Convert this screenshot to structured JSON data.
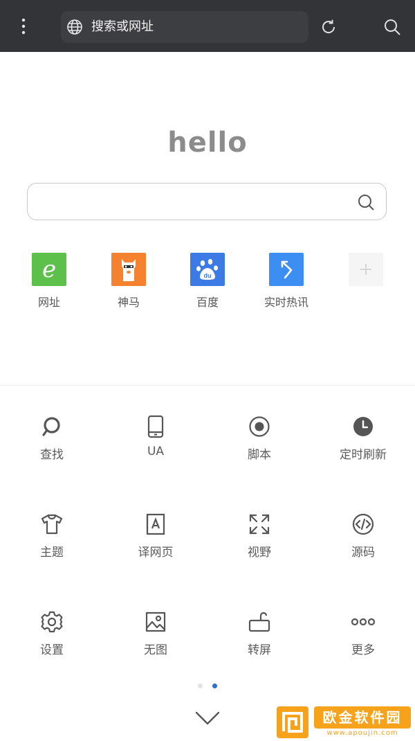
{
  "topbar": {
    "url_placeholder": "搜索或网址",
    "icons": [
      "more-vert-icon",
      "globe-icon",
      "refresh-icon",
      "search-icon"
    ]
  },
  "home": {
    "greeting": "hello",
    "search_icon": "search-icon"
  },
  "shortcuts": [
    {
      "label": "网址",
      "icon": "url-e-icon",
      "color": "#5cc04a"
    },
    {
      "label": "神马",
      "icon": "alpaca-icon",
      "color": "#f5822f"
    },
    {
      "label": "百度",
      "icon": "baidu-paw-icon",
      "color": "#3c7be6"
    },
    {
      "label": "实时热讯",
      "icon": "hot-news-arrow-icon",
      "color": "#3d8ef3"
    },
    {
      "label": "",
      "icon": "add-icon",
      "color": "#f5f5f5"
    }
  ],
  "menu": [
    {
      "label": "查找",
      "icon": "find-icon"
    },
    {
      "label": "UA",
      "icon": "phone-icon"
    },
    {
      "label": "脚本",
      "icon": "radio-target-icon"
    },
    {
      "label": "定时刷新",
      "icon": "clock-icon"
    },
    {
      "label": "主题",
      "icon": "tshirt-icon"
    },
    {
      "label": "译网页",
      "icon": "translate-icon"
    },
    {
      "label": "视野",
      "icon": "fullscreen-icon"
    },
    {
      "label": "源码",
      "icon": "code-icon"
    },
    {
      "label": "设置",
      "icon": "gear-icon"
    },
    {
      "label": "无图",
      "icon": "image-icon"
    },
    {
      "label": "转屏",
      "icon": "rotate-screen-icon"
    },
    {
      "label": "更多",
      "icon": "more-horiz-icon"
    }
  ],
  "pager": {
    "pages": 2,
    "active": 2,
    "active_color": "#2b6fd6",
    "inactive_color": "#e3e3e3"
  },
  "watermark": {
    "title": "欧金软件园",
    "subtitle": "www.apoujin.com"
  }
}
